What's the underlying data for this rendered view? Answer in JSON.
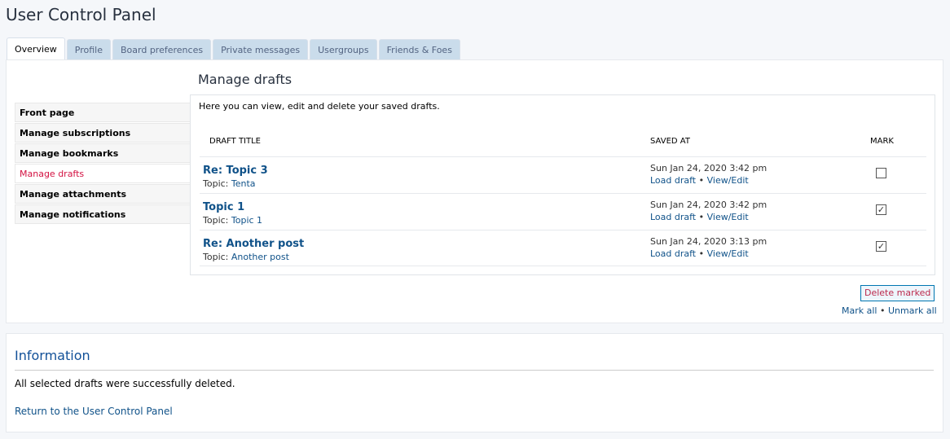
{
  "page_title": "User Control Panel",
  "tabs": [
    {
      "label": "Overview",
      "active": true
    },
    {
      "label": "Profile"
    },
    {
      "label": "Board preferences"
    },
    {
      "label": "Private messages"
    },
    {
      "label": "Usergroups"
    },
    {
      "label": "Friends & Foes"
    }
  ],
  "nav": [
    {
      "label": "Front page"
    },
    {
      "label": "Manage subscriptions"
    },
    {
      "label": "Manage bookmarks"
    },
    {
      "label": "Manage drafts",
      "active": true
    },
    {
      "label": "Manage attachments"
    },
    {
      "label": "Manage notifications"
    }
  ],
  "content": {
    "title": "Manage drafts",
    "intro": "Here you can view, edit and delete your saved drafts.",
    "headers": {
      "title": "DRAFT TITLE",
      "saved": "SAVED AT",
      "mark": "MARK"
    }
  },
  "drafts": [
    {
      "title": "Re: Topic 3",
      "topic_label": "Topic:",
      "topic": "Tenta",
      "date": "Sun Jan 24, 2020 3:42 pm",
      "load": "Load draft",
      "sep": "•",
      "edit": "View/Edit",
      "checked": false,
      "checkmark": ""
    },
    {
      "title": "Topic 1",
      "topic_label": "Topic:",
      "topic": "Topic 1",
      "date": "Sun Jan 24, 2020 3:42 pm",
      "load": "Load draft",
      "sep": "•",
      "edit": "View/Edit",
      "checked": true,
      "checkmark": "✓"
    },
    {
      "title": "Re: Another post",
      "topic_label": "Topic:",
      "topic": "Another post",
      "date": "Sun Jan 24, 2020 3:13 pm",
      "load": "Load draft",
      "sep": "•",
      "edit": "View/Edit",
      "checked": true,
      "checkmark": "✓"
    }
  ],
  "actions": {
    "delete_marked": "Delete marked",
    "mark_all": "Mark all",
    "sep": "•",
    "unmark_all": "Unmark all"
  },
  "info": {
    "heading": "Information",
    "message": "All selected drafts were successfully deleted.",
    "return_link": "Return to the User Control Panel"
  }
}
